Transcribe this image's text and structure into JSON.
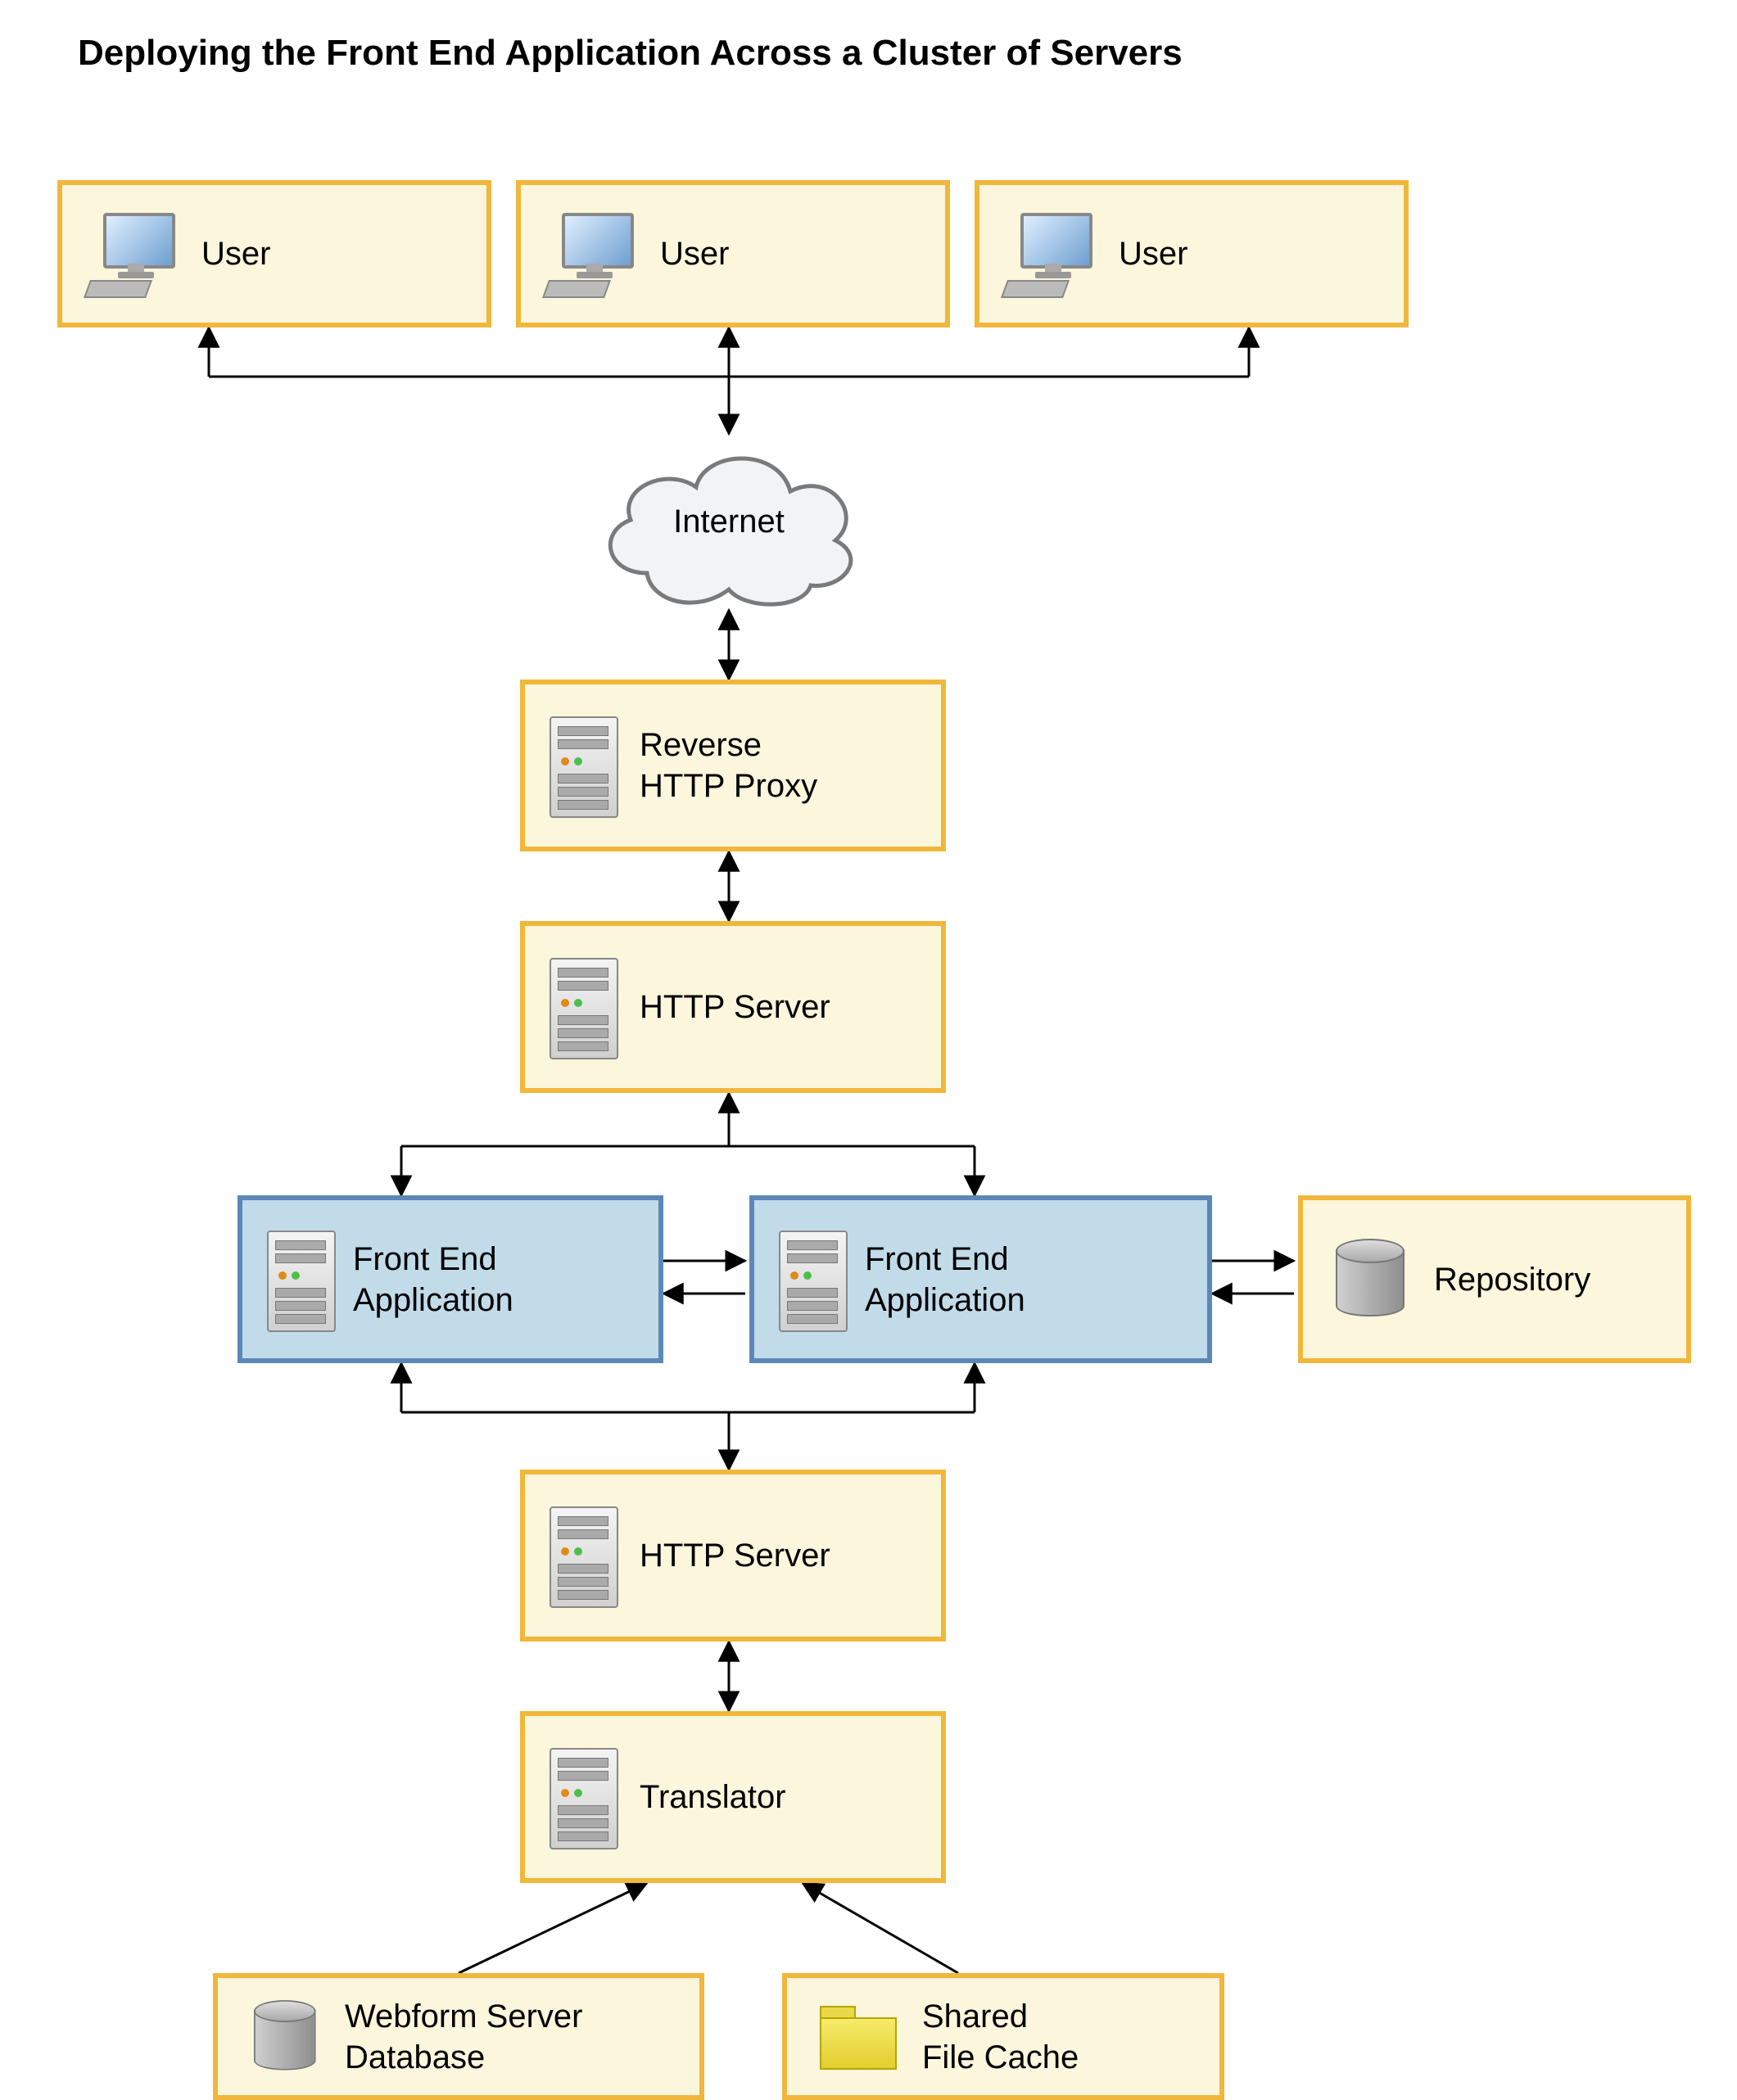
{
  "title": "Deploying the Front End Application Across a Cluster of Servers",
  "nodes": {
    "user1": "User",
    "user2": "User",
    "user3": "User",
    "internet": "Internet",
    "proxy": "Reverse\nHTTP Proxy",
    "http1": "HTTP Server",
    "fea1": "Front End\nApplication",
    "fea2": "Front End\nApplication",
    "repo": "Repository",
    "http2": "HTTP Server",
    "translator": "Translator",
    "wfdb": "Webform Server\nDatabase",
    "cache": "Shared\nFile Cache"
  }
}
